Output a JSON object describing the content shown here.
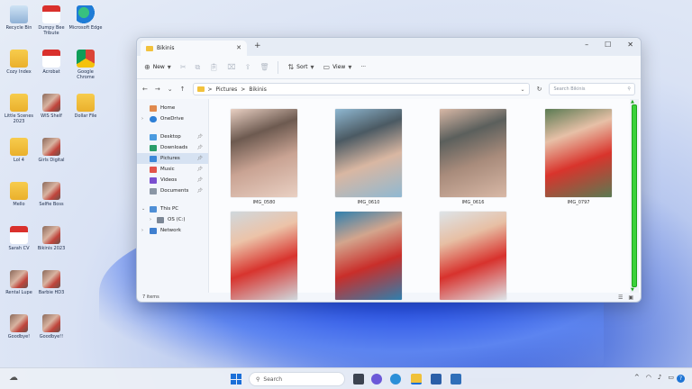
{
  "desktop": {
    "icons": [
      {
        "label": "Recycle Bin",
        "icon": "recycle-bin-icon"
      },
      {
        "label": "Dumpy Bee Tribute",
        "icon": "pdf-icon"
      },
      {
        "label": "Microsoft Edge",
        "icon": "edge-icon"
      },
      {
        "label": "Cozy Index",
        "icon": "folder-icon"
      },
      {
        "label": "Acrobat",
        "icon": "pdf-icon"
      },
      {
        "label": "Google Chrome",
        "icon": "chrome-icon"
      },
      {
        "label": "Little Scenes 2023",
        "icon": "folder-icon"
      },
      {
        "label": "WIS Shelf",
        "icon": "photo-icon"
      },
      {
        "label": "Dollar File",
        "icon": "folder-icon"
      },
      {
        "label": "Lol 4",
        "icon": "folder-icon"
      },
      {
        "label": "Girls Digital",
        "icon": "photo-icon"
      },
      {
        "label": "Mello",
        "icon": "folder-icon"
      },
      {
        "label": "Selfie Boss",
        "icon": "photo-icon"
      },
      {
        "label": "Sarah CV",
        "icon": "pdf-icon"
      },
      {
        "label": "Bikinis 2023",
        "icon": "photo-icon"
      },
      {
        "label": "Rental Lupe",
        "icon": "photo-icon"
      },
      {
        "label": "Barbie HD3",
        "icon": "photo-icon"
      },
      {
        "label": "Goodbye!",
        "icon": "photo-icon"
      },
      {
        "label": "Goodbye!!",
        "icon": "photo-icon"
      }
    ]
  },
  "explorer": {
    "tab_title": "Bikinis",
    "toolbar": {
      "new": "New",
      "sort": "Sort",
      "view": "View",
      "more": "···"
    },
    "breadcrumb": {
      "root": "Pictures",
      "separator": ">",
      "current": "Bikinis"
    },
    "search_placeholder": "Search Bikinis",
    "nav": {
      "home": "Home",
      "onedrive": "OneDrive",
      "desktop": "Desktop",
      "downloads": "Downloads",
      "pictures": "Pictures",
      "music": "Music",
      "videos": "Videos",
      "documents": "Documents",
      "this_pc": "This PC",
      "drive": "OS (C:)",
      "network": "Network"
    },
    "files": [
      {
        "name": "IMG_0580",
        "colors": [
          "#e9d0c3",
          "#c9a393",
          "#6d5a50"
        ]
      },
      {
        "name": "IMG_0610",
        "colors": [
          "#8fb8d2",
          "#d9b7a2",
          "#4b5a63"
        ]
      },
      {
        "name": "IMG_0616",
        "colors": [
          "#d8b8a6",
          "#a88b7b",
          "#5b5f5c"
        ]
      },
      {
        "name": "IMG_0797",
        "colors": [
          "#5a7a52",
          "#d9342c",
          "#e7c0a7"
        ]
      },
      {
        "name": "IMG_0801",
        "colors": [
          "#cfd8dd",
          "#d8342e",
          "#ecc3a8"
        ]
      },
      {
        "name": "IMG_0803",
        "colors": [
          "#2f7fae",
          "#c92e2a",
          "#d3a58d"
        ]
      },
      {
        "name": "IMG_0805",
        "colors": [
          "#dde4e8",
          "#d8322d",
          "#e7bfa4"
        ]
      }
    ],
    "status": "7 items"
  },
  "taskbar": {
    "search_label": "Search"
  },
  "colors": {
    "accent": "#1b6fd8",
    "scrollbar_highlight": "#3ad13a"
  }
}
